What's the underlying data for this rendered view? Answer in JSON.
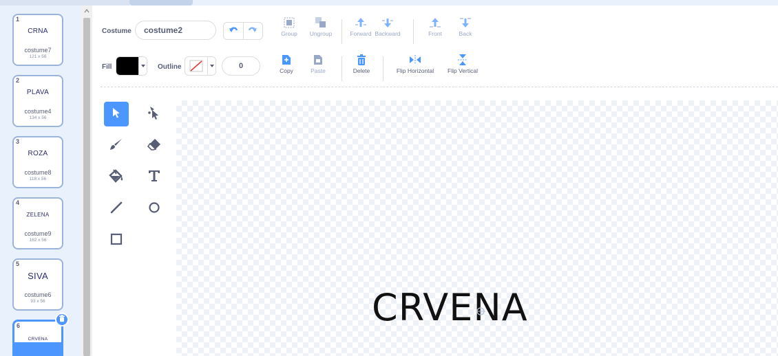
{
  "costumes": [
    {
      "number": "1",
      "thumb_text": "CRNA",
      "name": "costume7",
      "size": "121 x 56"
    },
    {
      "number": "2",
      "thumb_text": "PLAVA",
      "name": "costume4",
      "size": "134 x 56"
    },
    {
      "number": "3",
      "thumb_text": "ROZA",
      "name": "costume8",
      "size": "118 x 56"
    },
    {
      "number": "4",
      "thumb_text": "ZELENA",
      "name": "costume9",
      "size": "162 x 56"
    },
    {
      "number": "5",
      "thumb_text": "SIVA",
      "name": "costume6",
      "size": "93 x 56"
    },
    {
      "number": "6",
      "thumb_text": "CRVENA"
    }
  ],
  "toolbar": {
    "costume_label": "Costume",
    "costume_name": "costume2",
    "group": "Group",
    "ungroup": "Ungroup",
    "forward": "Forward",
    "backward": "Backward",
    "front": "Front",
    "back": "Back",
    "fill_label": "Fill",
    "outline_label": "Outline",
    "outline_width": "0",
    "copy": "Copy",
    "paste": "Paste",
    "delete": "Delete",
    "flip_horizontal": "Flip Horizontal",
    "flip_vertical": "Flip Vertical"
  },
  "tools": [
    "select",
    "reshape",
    "brush",
    "eraser",
    "fill",
    "text",
    "line",
    "circle",
    "rectangle"
  ],
  "canvas": {
    "text": "CRVENA"
  },
  "colors": {
    "accent": "#4c97ff",
    "fill": "#000000",
    "outline": "none",
    "text": "#575e75",
    "disabled": "#9aa8c8"
  }
}
